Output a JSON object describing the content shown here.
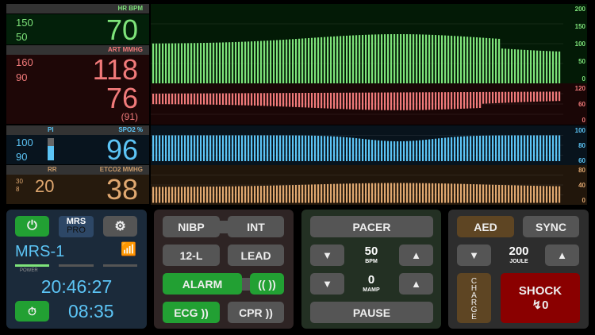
{
  "hr": {
    "label": "HR  BPM",
    "high": "150",
    "low": "50",
    "value": "70",
    "color": "#7ee37a"
  },
  "art": {
    "label": "ART  MMHG",
    "high": "160",
    "low": "90",
    "systolic": "118",
    "diastolic": "76",
    "mean": "(91)",
    "color": "#f07a7a"
  },
  "spo2": {
    "pi_label": "PI",
    "label": "SPO2  %",
    "high": "100",
    "low": "90",
    "value": "96",
    "pi_level": 0.65,
    "color": "#5cc4f5"
  },
  "etco2": {
    "rr_label": "RR",
    "label": "ETCO2  MMHG",
    "high": "30",
    "low": "8",
    "rr": "20",
    "value": "38",
    "color": "#e0a870"
  },
  "scales": {
    "hr": [
      "200",
      "150",
      "100",
      "50",
      "0"
    ],
    "art": [
      "120",
      "60",
      "0"
    ],
    "spo2": [
      "100",
      "80",
      "60"
    ],
    "etco2": [
      "80",
      "40",
      "0"
    ]
  },
  "device": {
    "logo_top": "MRS",
    "logo_bottom": "PRO",
    "name": "MRS-1",
    "power_label": "POWER",
    "clock": "20:46:27",
    "timer": "08:35"
  },
  "controls": {
    "nibp": "NIBP",
    "int": "INT",
    "twelve_lead": "12-L",
    "lead": "LEAD",
    "alarm": "ALARM",
    "ecg": "ECG",
    "cpr": "CPR"
  },
  "pacer": {
    "title": "PACER",
    "rate": "50",
    "rate_unit": "BPM",
    "current": "0",
    "current_unit": "MAMP",
    "pause": "PAUSE"
  },
  "defib": {
    "aed": "AED",
    "sync": "SYNC",
    "energy": "200",
    "energy_unit": "JOULE",
    "charge": "CHARGE",
    "shock": "SHOCK",
    "shock_count": "↯0"
  }
}
